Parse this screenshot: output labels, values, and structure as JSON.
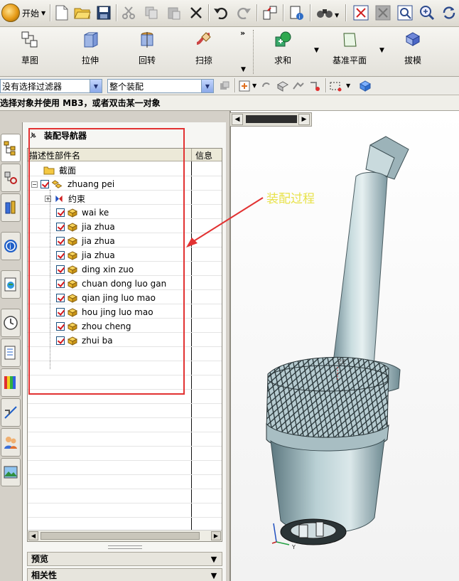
{
  "toolbar": {
    "start_label": "开始",
    "items": [
      "new-file-icon",
      "open-folder-icon",
      "save-icon",
      "cut-icon",
      "copy-icon",
      "paste-icon",
      "delete-icon",
      "undo-icon",
      "redo-icon",
      "window-icon",
      "info-icon",
      "binoculars-icon",
      "fit-view-icon",
      "zoom-box-icon",
      "zoom-fit-icon",
      "zoom-icon",
      "rotate-icon"
    ]
  },
  "features": {
    "items": [
      {
        "label": "草图",
        "icon": "sketch-icon"
      },
      {
        "label": "拉伸",
        "icon": "extrude-icon"
      },
      {
        "label": "回转",
        "icon": "revolve-icon"
      },
      {
        "label": "扫掠",
        "icon": "sweep-icon"
      },
      {
        "label": "求和",
        "icon": "unite-icon"
      },
      {
        "label": "基准平面",
        "icon": "datum-plane-icon"
      },
      {
        "label": "拔模",
        "icon": "draft-icon"
      }
    ],
    "overflow_label": "»"
  },
  "selection": {
    "filter_value": "没有选择过滤器",
    "scope_value": "整个装配"
  },
  "status": {
    "message": "选择对象并使用 MB3，或者双击某一对象"
  },
  "navigator": {
    "title": "装配导航器",
    "columns": [
      "描述性部件名",
      "信息"
    ],
    "rows": [
      {
        "label": "截面",
        "level": 0,
        "type": "folder"
      },
      {
        "label": "zhuang pei",
        "level": 0,
        "type": "assembly",
        "checked": true,
        "expander": "−"
      },
      {
        "label": "约束",
        "level": 1,
        "type": "constraints",
        "expander": "+"
      },
      {
        "label": "wai ke",
        "level": 1,
        "type": "part",
        "checked": true
      },
      {
        "label": "jia zhua",
        "level": 1,
        "type": "part",
        "checked": true
      },
      {
        "label": "jia zhua",
        "level": 1,
        "type": "part",
        "checked": true
      },
      {
        "label": "jia zhua",
        "level": 1,
        "type": "part",
        "checked": true
      },
      {
        "label": "ding xin zuo",
        "level": 1,
        "type": "part",
        "checked": true
      },
      {
        "label": "chuan dong luo gan",
        "level": 1,
        "type": "part",
        "checked": true
      },
      {
        "label": "qian jing luo mao",
        "level": 1,
        "type": "part",
        "checked": true
      },
      {
        "label": "hou jing luo mao",
        "level": 1,
        "type": "part",
        "checked": true
      },
      {
        "label": "zhou cheng",
        "level": 1,
        "type": "part",
        "checked": true
      },
      {
        "label": "zhui ba",
        "level": 1,
        "type": "part",
        "checked": true
      }
    ],
    "sections": [
      {
        "label": "预览"
      },
      {
        "label": "相关性"
      }
    ]
  },
  "annotation": {
    "text": "装配过程",
    "color": "#e8e24a",
    "box_color": "#e23232"
  },
  "model": {
    "axis_label": "ZC",
    "triad_label": "Y"
  }
}
